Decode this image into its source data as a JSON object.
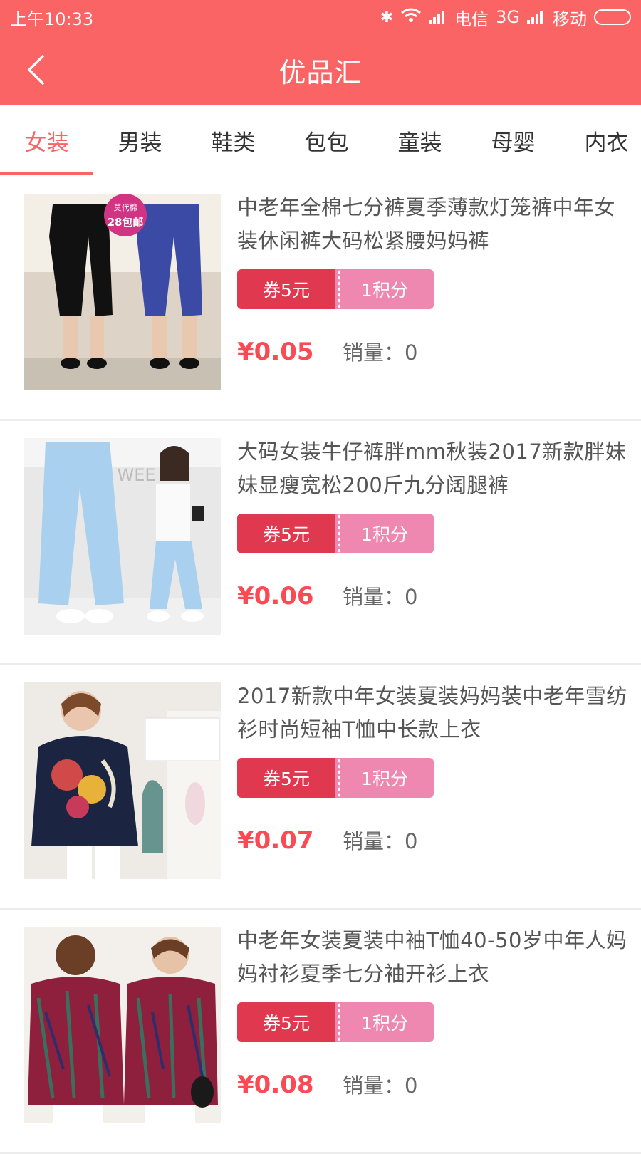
{
  "status_bar": {
    "time": "上午10:33",
    "carrier1": "电信",
    "network": "3G",
    "carrier2": "移动"
  },
  "header": {
    "title": "优品汇"
  },
  "tabs": [
    {
      "label": "女装",
      "active": true
    },
    {
      "label": "男装",
      "active": false
    },
    {
      "label": "鞋类",
      "active": false
    },
    {
      "label": "包包",
      "active": false
    },
    {
      "label": "童装",
      "active": false
    },
    {
      "label": "母婴",
      "active": false
    },
    {
      "label": "内衣",
      "active": false
    }
  ],
  "products": [
    {
      "name": "中老年全棉七分裤夏季薄款灯笼裤中年女装休闲裤大码松紧腰妈妈裤",
      "coupon": "券5元",
      "points": "1积分",
      "price": "¥0.05",
      "sales": "销量：0",
      "image_badge": "莫代棉",
      "image_badge_sub": "28包邮"
    },
    {
      "name": "大码女装牛仔裤胖mm秋装2017新款胖妹妹显瘦宽松200斤九分阔腿裤",
      "coupon": "券5元",
      "points": "1积分",
      "price": "¥0.06",
      "sales": "销量：0",
      "image_wall_text": "LO   WEE"
    },
    {
      "name": "2017新款中年女装夏装妈妈装中老年雪纺衫时尚短袖T恤中长款上衣",
      "coupon": "券5元",
      "points": "1积分",
      "price": "¥0.07",
      "sales": "销量：0"
    },
    {
      "name": "中老年女装夏装中袖T恤40-50岁中年人妈妈衬衫夏季七分袖开衫上衣",
      "coupon": "券5元",
      "points": "1积分",
      "price": "¥0.08",
      "sales": "销量：0"
    }
  ],
  "colors": {
    "brand": "#fa6464",
    "coupon": "#e0394f",
    "points": "#ef88b0",
    "price": "#fa4b55"
  }
}
